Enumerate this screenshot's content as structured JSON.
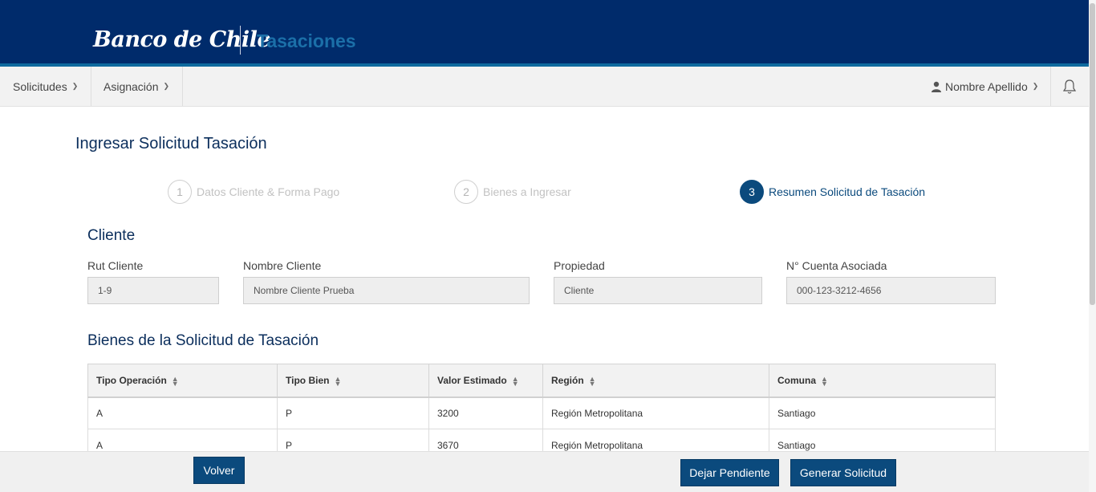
{
  "header": {
    "brand": "Banco de Chile",
    "app_title": "Tasaciones"
  },
  "nav": {
    "items": [
      {
        "label": "Solicitudes"
      },
      {
        "label": "Asignación"
      }
    ],
    "user_name": "Nombre Apellido"
  },
  "page": {
    "title": "Ingresar Solicitud Tasación"
  },
  "steps": [
    {
      "number": "1",
      "label": "Datos Cliente & Forma Pago",
      "active": false
    },
    {
      "number": "2",
      "label": "Bienes a Ingresar",
      "active": false
    },
    {
      "number": "3",
      "label": "Resumen Solicitud de Tasación",
      "active": true
    }
  ],
  "cliente": {
    "section_title": "Cliente",
    "fields": [
      {
        "label": "Rut Cliente",
        "value": "1-9"
      },
      {
        "label": "Nombre Cliente",
        "value": "Nombre Cliente Prueba"
      },
      {
        "label": "Propiedad",
        "value": "Cliente"
      },
      {
        "label": "N° Cuenta Asociada",
        "value": "000-123-3212-4656"
      }
    ]
  },
  "bienes": {
    "section_title": "Bienes de la Solicitud de Tasación",
    "columns": [
      "Tipo Operación",
      "Tipo Bien",
      "Valor Estimado",
      "Región",
      "Comuna"
    ],
    "rows": [
      [
        "A",
        "P",
        "3200",
        "Región Metropolitana",
        "Santiago"
      ],
      [
        "A",
        "P",
        "3670",
        "Región Metropolitana",
        "Santiago"
      ]
    ]
  },
  "footer": {
    "back_label": "Volver",
    "pending_label": "Dejar Pendiente",
    "generate_label": "Generar Solicitud"
  },
  "colors": {
    "header_bg": "#002b6b",
    "accent": "#0b4a7d",
    "app_title": "#1b6fa8"
  }
}
